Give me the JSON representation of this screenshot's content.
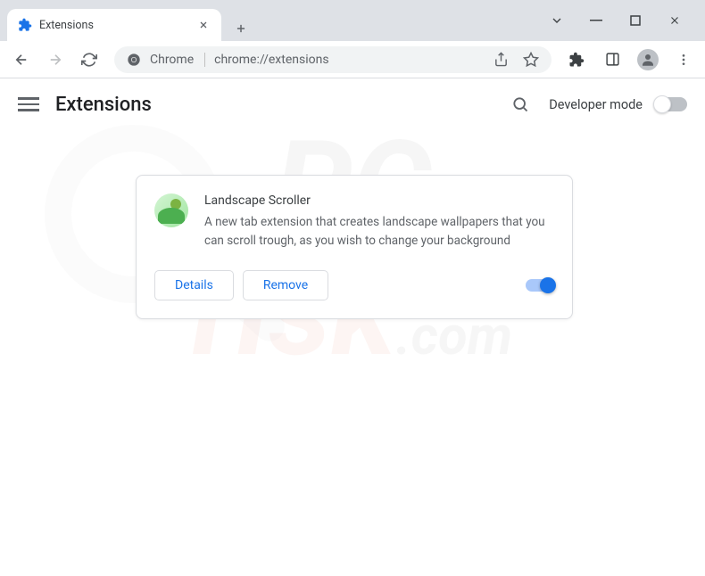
{
  "window": {
    "tab_title": "Extensions",
    "url_prefix": "Chrome",
    "url": "chrome://extensions"
  },
  "header": {
    "title": "Extensions",
    "dev_mode_label": "Developer mode",
    "dev_mode_enabled": false
  },
  "extension": {
    "name": "Landscape Scroller",
    "description": "A new tab extension that creates landscape wallpapers that you can scroll trough, as you wish to change your background",
    "details_label": "Details",
    "remove_label": "Remove",
    "enabled": true
  },
  "watermark": {
    "line1": "PC",
    "line2": "risk",
    "suffix": ".com"
  }
}
